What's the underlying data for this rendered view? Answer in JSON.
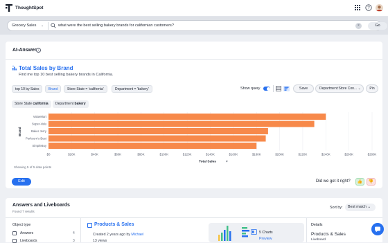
{
  "app": {
    "brand": "ThoughtSpot"
  },
  "search": {
    "datasource": "Grocery Sales",
    "query": "what were the best selling bakery brands for californian customers?",
    "go_label": "Go"
  },
  "ai": {
    "header": "AI-Answer"
  },
  "answer": {
    "title": "Total Sales by Brand",
    "subtitle": "Find me top 10 best selling bakery brands in California.",
    "tokens": [
      "top 10 by Sales",
      "Brand",
      "Store State = 'california'",
      "Department = 'bakery'"
    ],
    "filters": [
      {
        "label": "Store State",
        "value": "california"
      },
      {
        "label": "Department",
        "value": "bakery"
      }
    ],
    "show_query_label": "Show query",
    "save_label": "Save",
    "dropdown_label": "Department:Store Con...",
    "pin_label": "Pin",
    "showing_text": "Showing 5 of 5 data points",
    "edit_label": "Edit",
    "feedback_question": "Did we get it right?"
  },
  "chart_data": {
    "type": "bar",
    "orientation": "horizontal",
    "categories": [
      "ValueMart",
      "Super-Valu",
      "Baker Jerry",
      "Porkcorn's Best",
      "SimpleBuy"
    ],
    "values": [
      240000,
      230000,
      190000,
      188000,
      180000
    ],
    "xlabel": "Total Sales",
    "ylabel": "Brand",
    "xlim": [
      0,
      280000
    ],
    "xticks": [
      "$0",
      "$20K",
      "$40K",
      "$60K",
      "$80K",
      "$100K",
      "$120K",
      "$140K",
      "$160K",
      "$180K",
      "$200K",
      "$220K",
      "$240K",
      "$260K",
      "$280K"
    ],
    "bar_color": "#f7894a"
  },
  "liveboards": {
    "header": "Answers and Liveboards",
    "found": "Found 7 results",
    "sort_label": "Sort by:",
    "sort_value": "Best match",
    "object_type_label": "Object type",
    "filters": [
      {
        "label": "Answers",
        "count": "4"
      },
      {
        "label": "Liveboards",
        "count": "3"
      }
    ],
    "result": {
      "title": "Products & Sales",
      "created_prefix": "Created 2 years ago by",
      "author": "Michael",
      "views": "13 views",
      "charts": "5 Charts",
      "preview": "Preview"
    },
    "details": {
      "heading": "Details",
      "name": "Products & Sales",
      "type": "Liveboard"
    }
  }
}
